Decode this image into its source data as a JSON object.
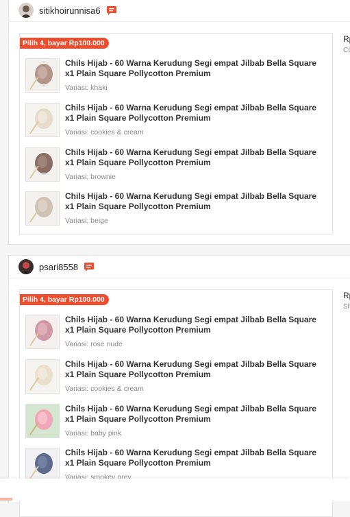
{
  "orders": [
    {
      "username": "sitikhoirunnisa6",
      "price_label": "Rp",
      "price_sub": "CO",
      "promo": "Pilih 4, bayar Rp100.000",
      "items": [
        {
          "title": "Chils Hijab - 60 Warna Kerudung Segi empat Jilbab Bella Square  x1 Plain Square Pollycotton Premium",
          "variant": "Variasi: khaki",
          "color": "#b39489"
        },
        {
          "title": "Chils Hijab - 60 Warna Kerudung Segi empat Jilbab Bella Square  x1 Plain Square Pollycotton Premium",
          "variant": "Variasi: cookies & cream",
          "color": "#e6dccb"
        },
        {
          "title": "Chils Hijab - 60 Warna Kerudung Segi empat Jilbab Bella Square  x1 Plain Square Pollycotton Premium",
          "variant": "Variasi: brownie",
          "color": "#8a6e64"
        },
        {
          "title": "Chils Hijab - 60 Warna Kerudung Segi empat Jilbab Bella Square  x1 Plain Square Pollycotton Premium",
          "variant": "Variasi: beige",
          "color": "#cfc2b3"
        }
      ]
    },
    {
      "username": "psari8558",
      "price_label": "Rp",
      "price_sub": "Sh",
      "promo": "Pilih 4, bayar Rp100.000",
      "items": [
        {
          "title": "Chils Hijab - 60 Warna Kerudung Segi empat Jilbab Bella Square  x1 Plain Square Pollycotton Premium",
          "variant": "Variasi: rose nude",
          "color": "#cf98a4"
        },
        {
          "title": "Chils Hijab - 60 Warna Kerudung Segi empat Jilbab Bella Square  x1 Plain Square Pollycotton Premium",
          "variant": "Variasi: cookies & cream",
          "color": "#e8dfcd"
        },
        {
          "title": "Chils Hijab - 60 Warna Kerudung Segi empat Jilbab Bella Square  x1 Plain Square Pollycotton Premium",
          "variant": "Variasi: baby pink",
          "color": "#f0a6b6"
        },
        {
          "title": "Chils Hijab - 60 Warna Kerudung Segi empat Jilbab Bella Square  x1 Plain Square Pollycotton Premium",
          "variant": "Variasi: smokey grey",
          "color": "#5e6a8e"
        }
      ]
    }
  ],
  "icons": {
    "chat": "chat-icon",
    "avatar": "avatar"
  },
  "colors": {
    "accent": "#ee4d2d"
  }
}
